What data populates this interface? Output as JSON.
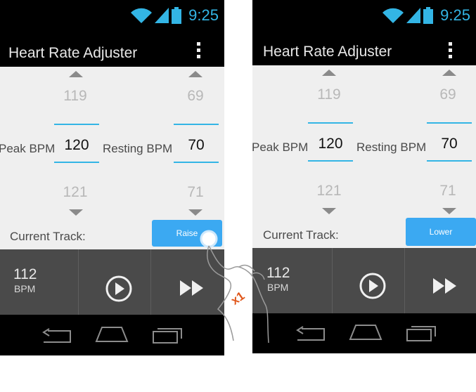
{
  "colors": {
    "accent": "#33b5e5",
    "button": "#3ba9f2",
    "bar": "#000000",
    "player": "#4a4a4a"
  },
  "screens": [
    {
      "status": {
        "time": "9:25",
        "icons": [
          "wifi-icon",
          "signal-icon",
          "battery-icon"
        ]
      },
      "app_title": "Heart Rate Adjuster",
      "peak": {
        "label": "Peak BPM",
        "prev": "119",
        "value": "120",
        "next": "121"
      },
      "resting": {
        "label": "Resting BPM",
        "prev": "69",
        "value": "70",
        "next": "71"
      },
      "track_label": "Current Track:",
      "action_button": "Raise",
      "player": {
        "bpm_value": "112",
        "bpm_unit": "BPM"
      }
    },
    {
      "status": {
        "time": "9:25",
        "icons": [
          "wifi-icon",
          "signal-icon",
          "battery-icon"
        ]
      },
      "app_title": "Heart Rate Adjuster",
      "peak": {
        "label": "Peak BPM",
        "prev": "119",
        "value": "120",
        "next": "121"
      },
      "resting": {
        "label": "Resting BPM",
        "prev": "69",
        "value": "70",
        "next": "71"
      },
      "track_label": "Current Track:",
      "action_button": "Lower",
      "player": {
        "bpm_value": "112",
        "bpm_unit": "BPM"
      }
    }
  ],
  "gesture": {
    "tap_count": "x1"
  }
}
